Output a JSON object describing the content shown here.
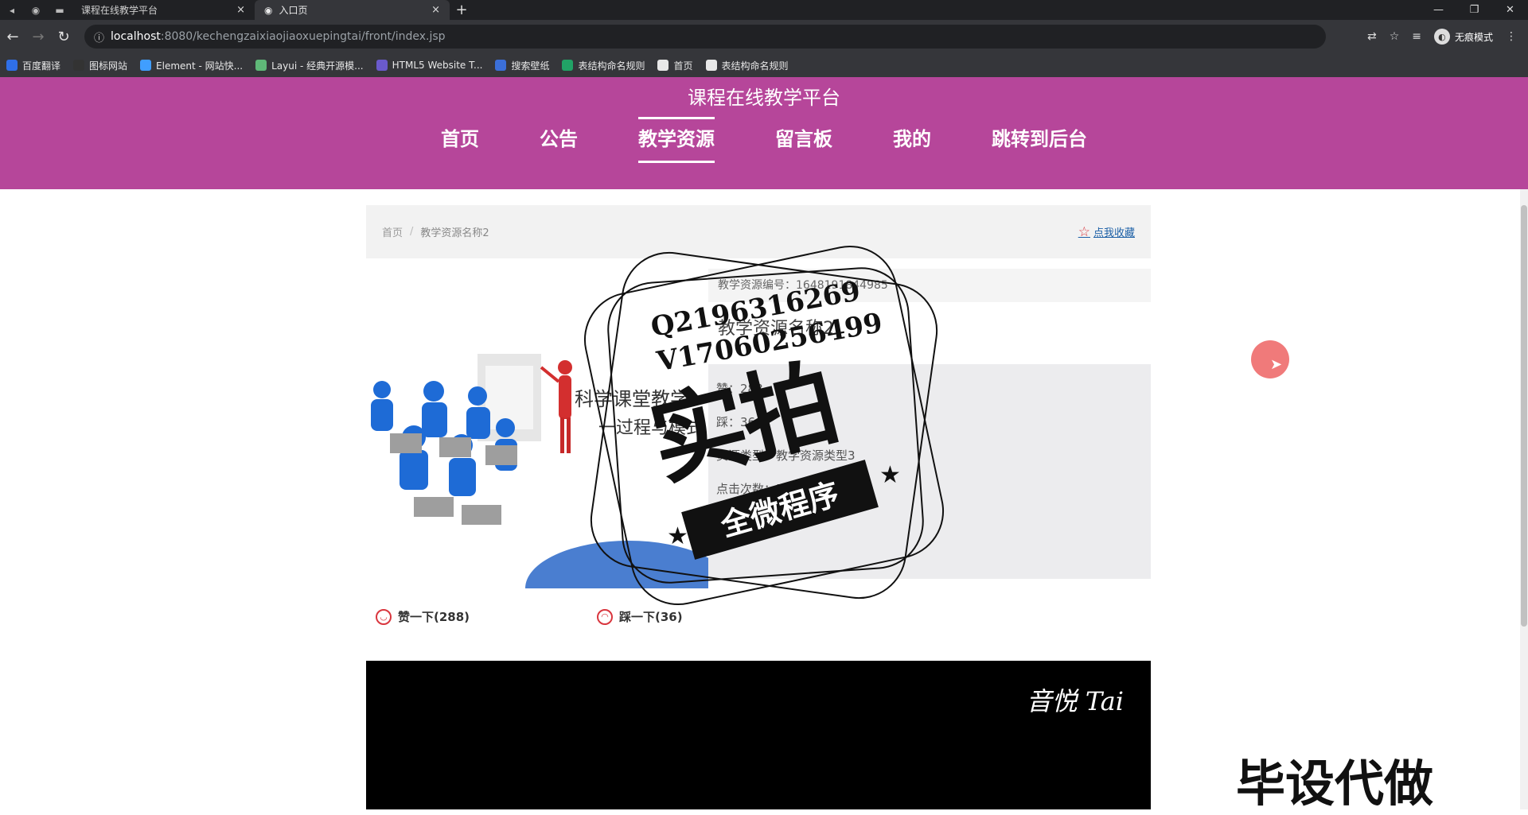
{
  "browser": {
    "tabs": [
      {
        "title": "课程在线教学平台",
        "close": "×"
      },
      {
        "title": "入口页",
        "close": "×"
      }
    ],
    "new_tab": "+",
    "window_controls": [
      "—",
      "❐",
      "✕"
    ],
    "url_host": "localhost",
    "url_rest": ":8080/kechengzaixiaojiaoxuepingtai/front/index.jsp",
    "incognito_label": "无痕模式",
    "bookmarks": [
      {
        "label": "百度翻译",
        "color": "#2f6fe8"
      },
      {
        "label": "图标网站",
        "color": "#333333"
      },
      {
        "label": "Element - 网站快...",
        "color": "#409eff"
      },
      {
        "label": "Layui - 经典开源模...",
        "color": "#5fb878"
      },
      {
        "label": "HTML5 Website T...",
        "color": "#6a5acd"
      },
      {
        "label": "搜索壁纸",
        "color": "#3b6fd8"
      },
      {
        "label": "表结构命名规则",
        "color": "#21a366"
      },
      {
        "label": "首页",
        "color": "#e8e8e8"
      },
      {
        "label": "表结构命名规则",
        "color": "#e8e8e8"
      }
    ]
  },
  "site": {
    "title": "课程在线教学平台",
    "nav": [
      "首页",
      "公告",
      "教学资源",
      "留言板",
      "我的",
      "跳转到后台"
    ],
    "active_nav": "教学资源",
    "header_color": "#b6469a"
  },
  "breadcrumb": {
    "home": "首页",
    "separator": "/",
    "current": "教学资源名称2"
  },
  "favorite_label": "点我收藏",
  "resource": {
    "code": "教学资源编号：1648191844985",
    "name": "教学资源名称2",
    "likes": "赞：288",
    "dislikes": "踩：36",
    "type": "资源类型：教学资源类型3",
    "clicks": "点击次数：58",
    "cover_caption_1": "科学课堂教学",
    "cover_caption_2": "一过程与模式"
  },
  "votes": {
    "like": "赞一下(288)",
    "dislike": "踩一下(36)"
  },
  "video_watermark": "音悦 Tai",
  "overlays": {
    "stamp_contact_1": "Q2196316269",
    "stamp_contact_2": "V17060256499",
    "stamp_big": "实拍",
    "stamp_ribbon": "全微程序",
    "corner_text": "毕设代做"
  }
}
